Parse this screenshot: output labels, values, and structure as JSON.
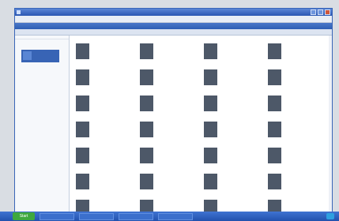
{
  "window": {
    "title": "",
    "menu": [
      "",
      "",
      "",
      ""
    ]
  },
  "app": {
    "title": "",
    "toolbar": [
      "",
      "",
      "",
      ""
    ]
  },
  "sidebar": {
    "title": "",
    "item_label": ""
  },
  "groups": [
    {
      "header": "",
      "items": [
        {
          "name": "",
          "meta": ""
        },
        {
          "name": "",
          "meta": ""
        },
        {
          "name": "",
          "meta": ""
        },
        {
          "name": "",
          "meta": ""
        }
      ]
    },
    {
      "header": "",
      "items": [
        {
          "name": "",
          "meta": ""
        },
        {
          "name": "",
          "meta": ""
        },
        {
          "name": "",
          "meta": ""
        },
        {
          "name": "",
          "meta": ""
        }
      ]
    },
    {
      "header": "",
      "items": [
        {
          "name": "",
          "meta": ""
        },
        {
          "name": "",
          "meta": ""
        },
        {
          "name": "",
          "meta": ""
        },
        {
          "name": "",
          "meta": ""
        }
      ]
    },
    {
      "header": "",
      "items": [
        {
          "name": "",
          "meta": ""
        },
        {
          "name": "",
          "meta": ""
        },
        {
          "name": "",
          "meta": ""
        },
        {
          "name": "",
          "meta": ""
        }
      ]
    },
    {
      "header": "",
      "items": [
        {
          "name": "",
          "meta": ""
        },
        {
          "name": "",
          "meta": ""
        },
        {
          "name": "",
          "meta": ""
        },
        {
          "name": "",
          "meta": ""
        }
      ]
    },
    {
      "header": "",
      "items": [
        {
          "name": "",
          "meta": ""
        },
        {
          "name": "",
          "meta": ""
        },
        {
          "name": "",
          "meta": ""
        },
        {
          "name": "",
          "meta": ""
        }
      ]
    },
    {
      "header": "",
      "items": [
        {
          "name": "",
          "meta": ""
        },
        {
          "name": "",
          "meta": ""
        },
        {
          "name": "",
          "meta": ""
        },
        {
          "name": "",
          "meta": ""
        }
      ]
    }
  ],
  "taskbar": {
    "start_label": "Start",
    "tasks": [
      "",
      "",
      "",
      ""
    ]
  },
  "colors": {
    "accent": "#2b57b2",
    "thumb": "#4d5868",
    "start": "#3ea83e"
  }
}
